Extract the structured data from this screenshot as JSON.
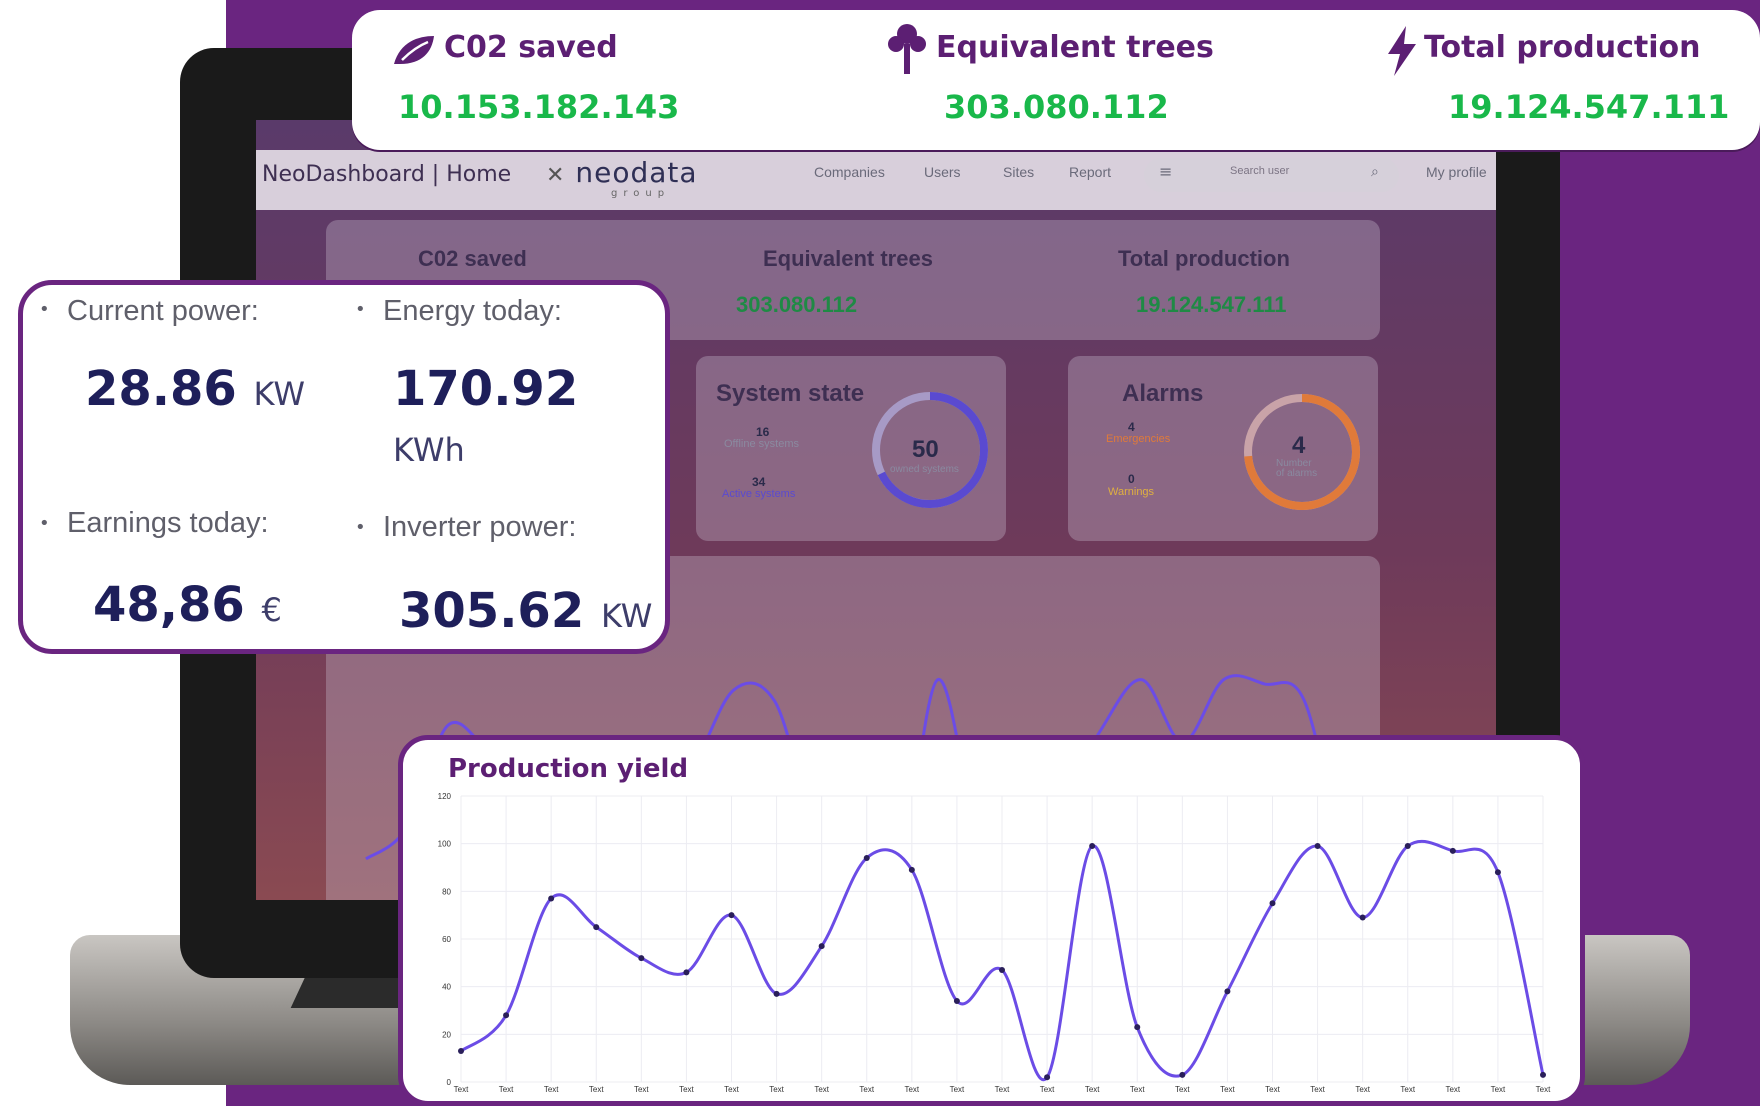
{
  "stats": {
    "co2": {
      "label": "C02 saved",
      "value": "10.153.182.143",
      "icon": "leaf-icon"
    },
    "trees": {
      "label": "Equivalent trees",
      "value": "303.080.112",
      "icon": "tree-icon"
    },
    "production": {
      "label": "Total production",
      "value": "19.124.547.111",
      "icon": "lightning-icon"
    }
  },
  "dashboard": {
    "title": "NeoDashboard",
    "page": "Home",
    "logo": "neodata",
    "logo_sub": "group",
    "nav": [
      "Companies",
      "Users",
      "Sites",
      "Report"
    ],
    "search_placeholder": "Search user",
    "profile": "My profile",
    "stats": {
      "co2_label": "C02 saved",
      "trees_label": "Equivalent trees",
      "trees_value": "303.080.112",
      "production_label": "Total production",
      "production_value": "19.124.547.111"
    },
    "system_state": {
      "title": "System state",
      "offline_count": "16",
      "offline_label": "Offline systems",
      "active_count": "34",
      "active_label": "Active systems",
      "total": "50",
      "total_label": "owned systems"
    },
    "alarms": {
      "title": "Alarms",
      "emergencies_count": "4",
      "emergencies_label": "Emergencies",
      "warnings_count": "0",
      "warnings_label": "Warnings",
      "total": "4",
      "total_label_1": "Number",
      "total_label_2": "of alarms"
    }
  },
  "power": {
    "current": {
      "label": "Current power:",
      "value": "28.86",
      "unit": "KW"
    },
    "energy": {
      "label": "Energy today:",
      "value": "170.92",
      "unit": "KWh"
    },
    "earnings": {
      "label": "Earnings today:",
      "value": "48,86",
      "unit": "€"
    },
    "inverter": {
      "label": "Inverter power:",
      "value": "305.62",
      "unit": "KW"
    }
  },
  "colors": {
    "brand_purple": "#6a2580",
    "value_green": "#19b84a",
    "line": "#6b4ce6",
    "alarm_orange": "#e07a3a",
    "warning_yellow": "#e0b040"
  },
  "chart_data": {
    "type": "line",
    "title": "Production yield",
    "xlabel": "",
    "ylabel": "",
    "ylim": [
      0,
      120
    ],
    "yticks": [
      0,
      20,
      40,
      60,
      80,
      100,
      120
    ],
    "grid": true,
    "categories": [
      "Text",
      "Text",
      "Text",
      "Text",
      "Text",
      "Text",
      "Text",
      "Text",
      "Text",
      "Text",
      "Text",
      "Text",
      "Text",
      "Text",
      "Text",
      "Text",
      "Text",
      "Text",
      "Text",
      "Text",
      "Text",
      "Text",
      "Text",
      "Text",
      "Text"
    ],
    "series": [
      {
        "values": [
          13,
          28,
          77,
          65,
          52,
          46,
          70,
          37,
          57,
          94,
          89,
          34,
          47,
          2,
          99,
          23,
          3,
          38,
          75,
          99,
          69,
          99,
          97,
          88,
          3
        ]
      }
    ]
  }
}
